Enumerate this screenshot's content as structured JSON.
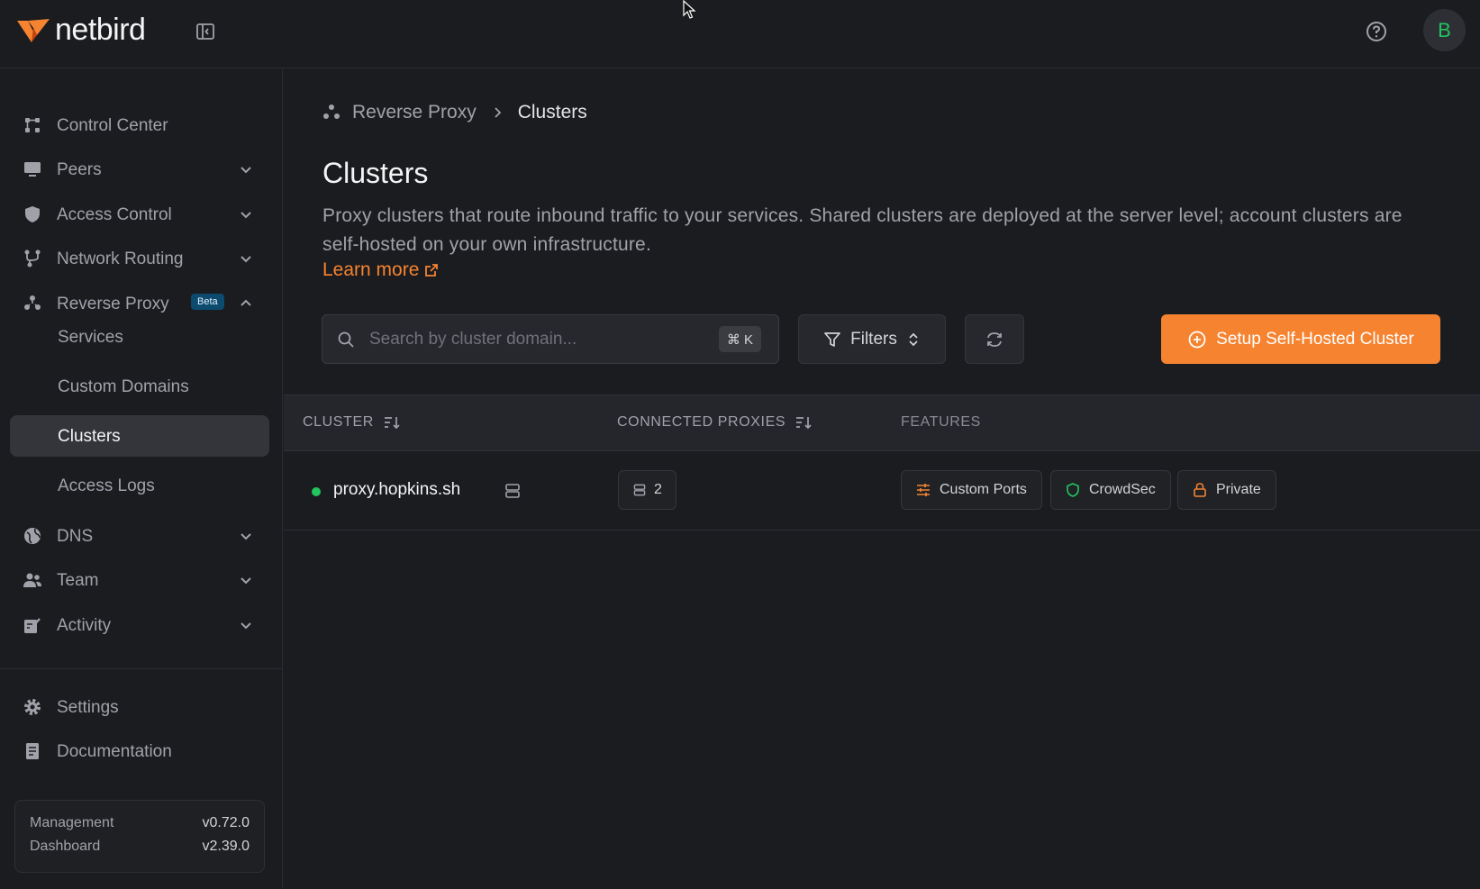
{
  "header": {
    "brand": "netbird",
    "avatar_initial": "B",
    "brand_color": "#f68330"
  },
  "sidebar": {
    "items": [
      {
        "label": "Control Center",
        "icon": "dashboard-icon"
      },
      {
        "label": "Peers",
        "icon": "monitor-icon"
      },
      {
        "label": "Access Control",
        "icon": "shield-icon"
      },
      {
        "label": "Network Routing",
        "icon": "network-icon"
      },
      {
        "label": "Reverse Proxy",
        "icon": "proxy-icon",
        "badge": "Beta"
      },
      {
        "label": "DNS",
        "icon": "globe-icon"
      },
      {
        "label": "Team",
        "icon": "users-icon"
      },
      {
        "label": "Activity",
        "icon": "activity-icon"
      }
    ],
    "subitems": [
      {
        "label": "Services"
      },
      {
        "label": "Custom Domains"
      },
      {
        "label": "Clusters",
        "active": true
      },
      {
        "label": "Access Logs"
      }
    ],
    "footer_items": [
      {
        "label": "Settings",
        "icon": "gear-icon"
      },
      {
        "label": "Documentation",
        "icon": "document-icon"
      }
    ],
    "versions": {
      "management_label": "Management",
      "management_value": "v0.72.0",
      "dashboard_label": "Dashboard",
      "dashboard_value": "v2.39.0"
    }
  },
  "breadcrumb": {
    "parent": "Reverse Proxy",
    "current": "Clusters"
  },
  "page": {
    "title": "Clusters",
    "description": "Proxy clusters that route inbound traffic to your services. Shared clusters are deployed at the server level; account clusters are self-hosted on your own infrastructure.",
    "learn_more": "Learn more"
  },
  "toolbar": {
    "search_placeholder": "Search by cluster domain...",
    "search_shortcut": "⌘ K",
    "filters_label": "Filters",
    "setup_label": "Setup Self-Hosted Cluster"
  },
  "table": {
    "columns": [
      "CLUSTER",
      "CONNECTED PROXIES",
      "FEATURES"
    ],
    "rows": [
      {
        "cluster": "proxy.hopkins.sh",
        "status_color": "#22c55e",
        "connected_proxies": "2",
        "features": [
          "Custom Ports",
          "CrowdSec",
          "Private"
        ]
      }
    ]
  }
}
